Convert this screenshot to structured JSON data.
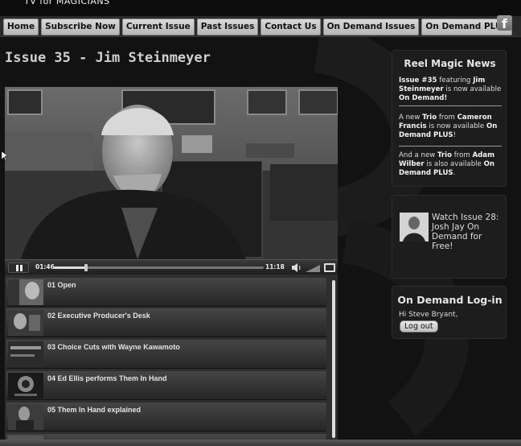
{
  "header": {
    "logo_text": "TV for MAGICIANS",
    "facebook_icon": "facebook-icon"
  },
  "nav": {
    "items": [
      {
        "label": "Home"
      },
      {
        "label": "Subscribe Now"
      },
      {
        "label": "Current Issue"
      },
      {
        "label": "Past Issues"
      },
      {
        "label": "Contact Us"
      },
      {
        "label": "On Demand Issues"
      },
      {
        "label": "On Demand PLUS"
      }
    ]
  },
  "main": {
    "title": "Issue 35 - Jim Steinmeyer"
  },
  "player": {
    "elapsed": "01:46",
    "duration": "11:18",
    "progress_fraction": 0.157,
    "icons": {
      "pause": "pause-icon",
      "volume": "volume-icon",
      "fullscreen": "fullscreen-icon"
    },
    "playlist": [
      {
        "label": "01 Open"
      },
      {
        "label": "02 Executive Producer's Desk"
      },
      {
        "label": "03 Choice Cuts with Wayne Kawamoto"
      },
      {
        "label": "04 Ed Ellis performs Them In Hand"
      },
      {
        "label": "05 Them In Hand explained"
      }
    ]
  },
  "sidebar": {
    "news": {
      "heading": "Reel Magic News",
      "item1": {
        "a": "Issue #35",
        "b": " featuring ",
        "c": "Jim Steinmeyer",
        "d": " is now available ",
        "e": "On Demand!"
      },
      "item2": {
        "a": "A new ",
        "b": "Trio",
        "c": " from ",
        "d": "Cameron Francis",
        "e": " is now available ",
        "f": "On Demand PLUS",
        "g": "!"
      },
      "item3": {
        "a": "And a new ",
        "b": "Trio",
        "c": " from ",
        "d": "Adam Wilber",
        "e": " is also available ",
        "f": "On Demand PLUS",
        "g": "."
      }
    },
    "promo": {
      "text": "Watch Issue 28: Josh Jay On Demand for Free!"
    },
    "login": {
      "heading": "On Demand Log-in",
      "greeting": "Hi Steve Bryant,",
      "logout_label": "Log out"
    }
  }
}
